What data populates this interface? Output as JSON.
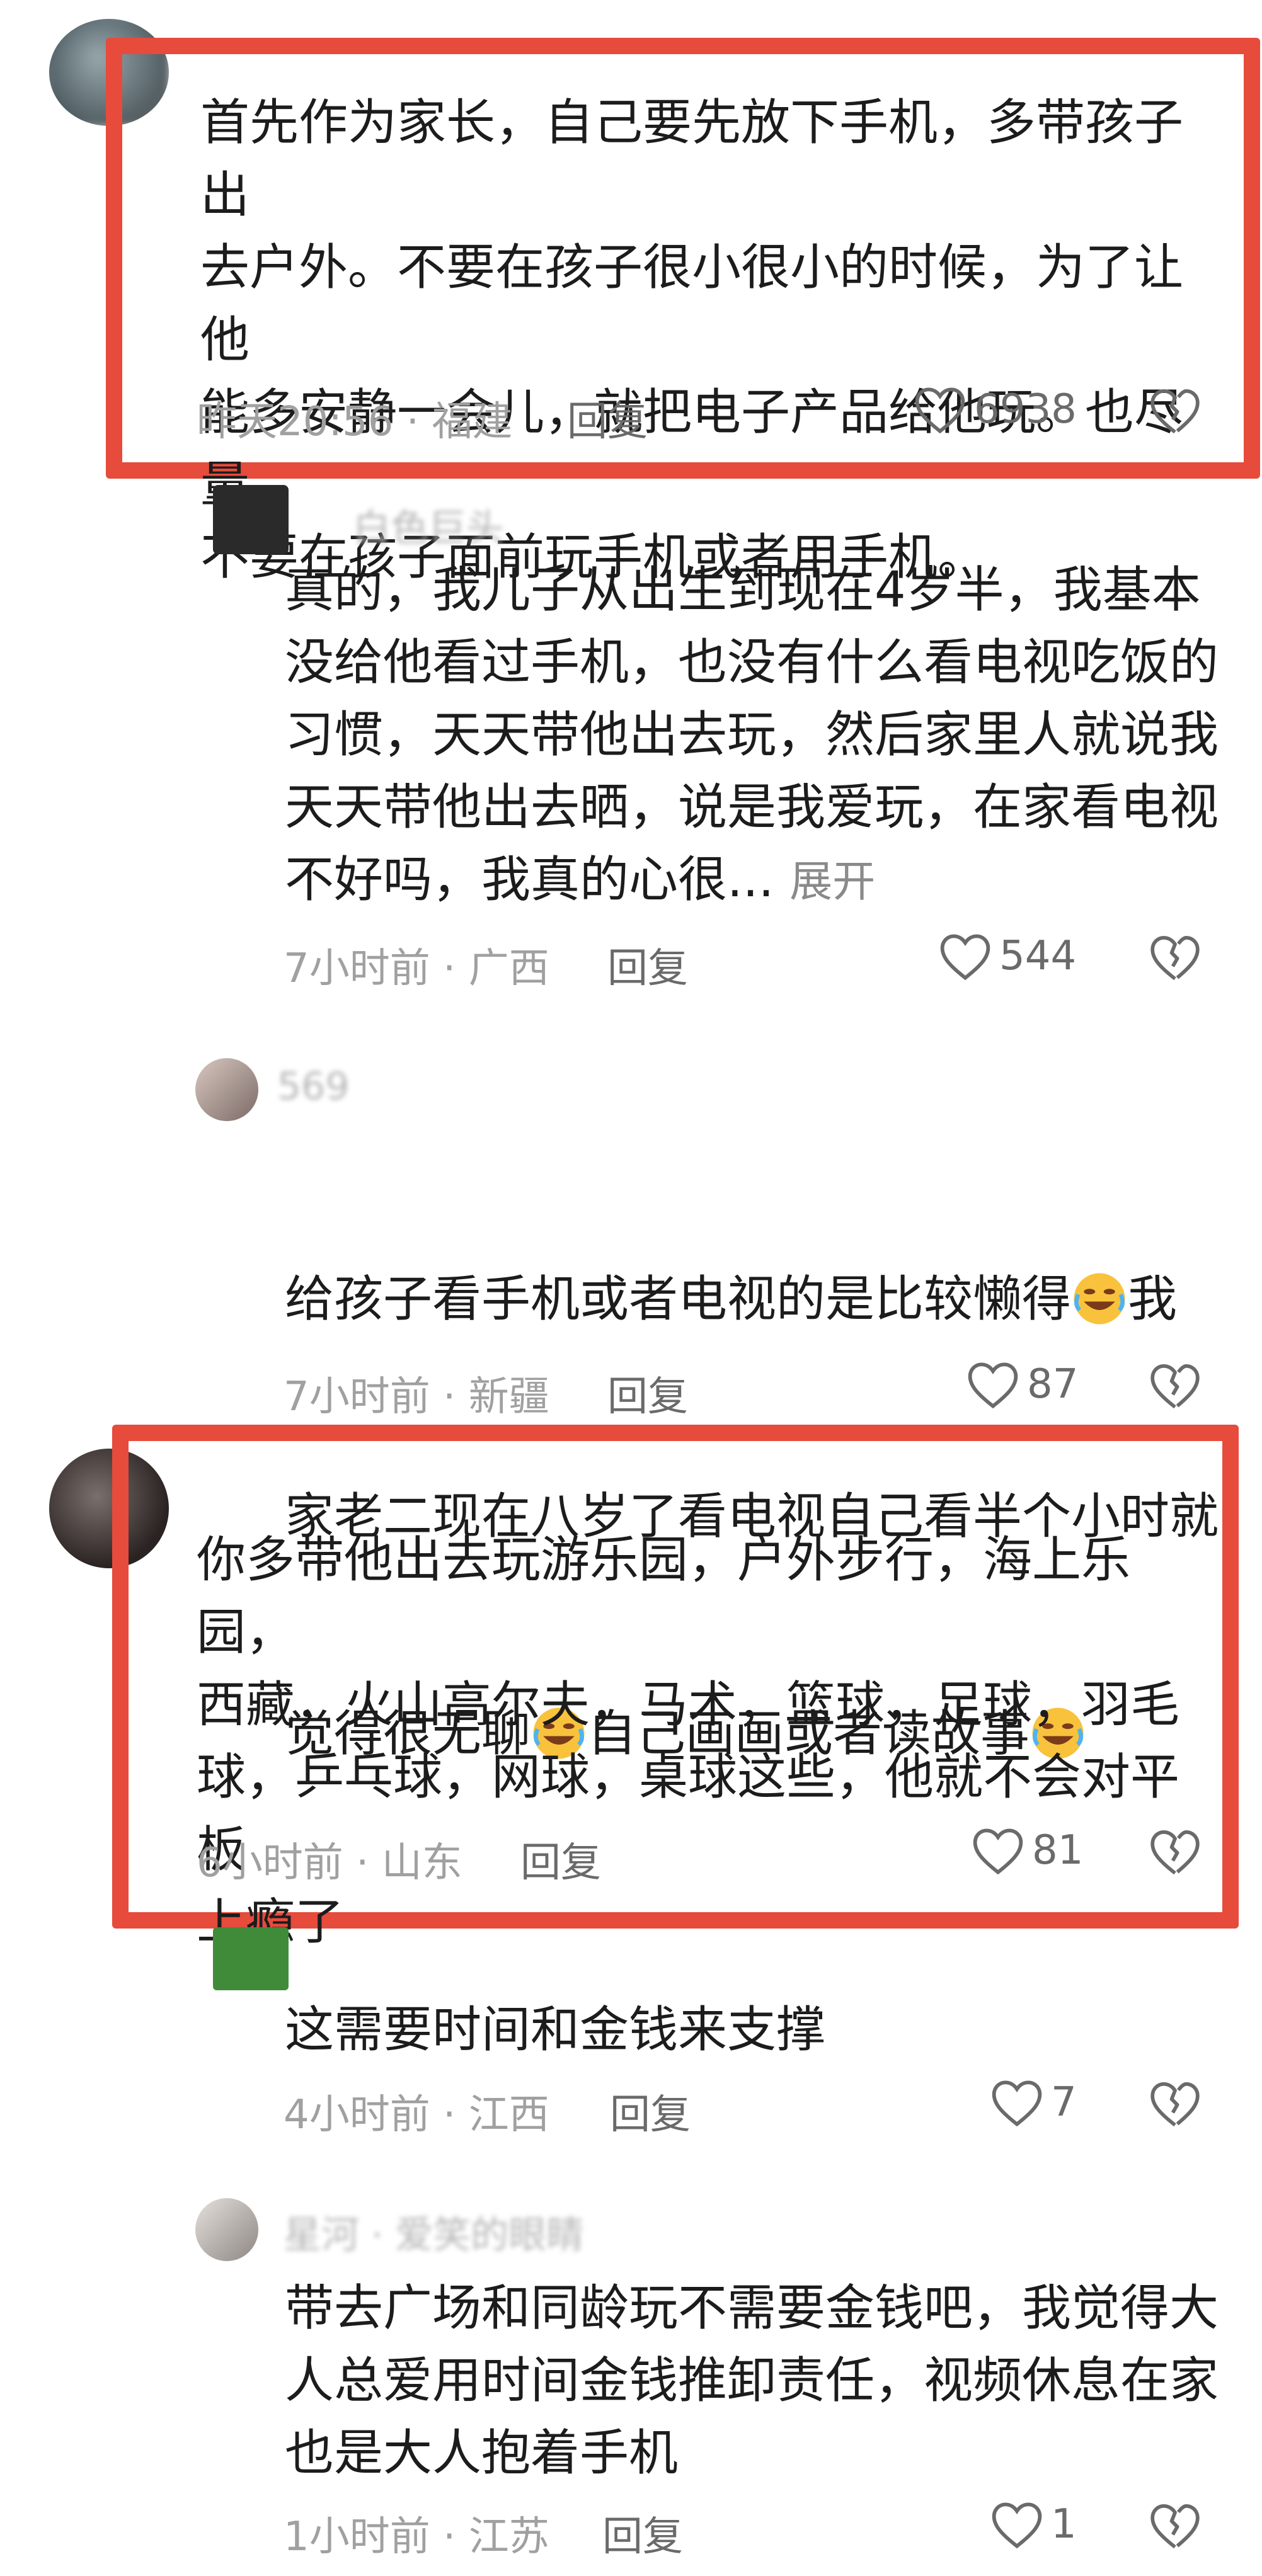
{
  "comments": [
    {
      "text": "首先作为家长，自己要先放下手机，多带孩子出\n去户外。不要在孩子很小很小的时候，为了让他\n能多安静一会儿，就把电子产品给他玩。也尽量\n不要在孩子面前玩手机或者用手机。",
      "time": "昨天20:56 · 福建",
      "reply": "回复",
      "likes": "6938"
    },
    {
      "text": "真的，我儿子从出生到现在4岁半，我基本\n没给他看过手机，也没有什么看电视吃饭的\n习惯，天天带他出去玩，然后家里人就说我\n天天带他出去晒，说是我爱玩，在家看电视\n不好吗，我真的心很...",
      "expand": "展开",
      "time": "7小时前 · 广西",
      "reply": "回复",
      "likes": "544"
    },
    {
      "line1": "给孩子看手机或者电视的是比较懒得",
      "line1b": "我",
      "line2": "家老二现在八岁了看电视自己看半个小时就",
      "line3": "觉得很无聊",
      "line3b": "自己画画或者读故事",
      "time": "7小时前 · 新疆",
      "reply": "回复",
      "likes": "87",
      "name": "569"
    },
    {
      "text": "你多带他出去玩游乐园，户外步行，海上乐园，\n西藏，火山高尔夫，马术，篮球，足球，羽毛\n球，乒乓球，网球，桌球这些，他就不会对平板\n上瘾了",
      "time": "6小时前 · 山东",
      "reply": "回复",
      "likes": "81"
    },
    {
      "text": "这需要时间和金钱来支撑",
      "time": "4小时前 · 江西",
      "reply": "回复",
      "likes": "7"
    },
    {
      "text": "带去广场和同龄玩不需要金钱吧，我觉得大\n人总爱用时间金钱推卸责任，视频休息在家\n也是大人抱着手机",
      "time": "1小时前 · 江苏",
      "reply": "回复",
      "likes": "1"
    }
  ],
  "icons": {
    "like": "heart-outline-icon",
    "dislike": "broken-heart-icon",
    "emoji": "rofl-emoji-icon"
  },
  "colors": {
    "highlight_box": "#e64b3c",
    "meta": "#a0a0a0",
    "text": "#1c1c1c"
  }
}
